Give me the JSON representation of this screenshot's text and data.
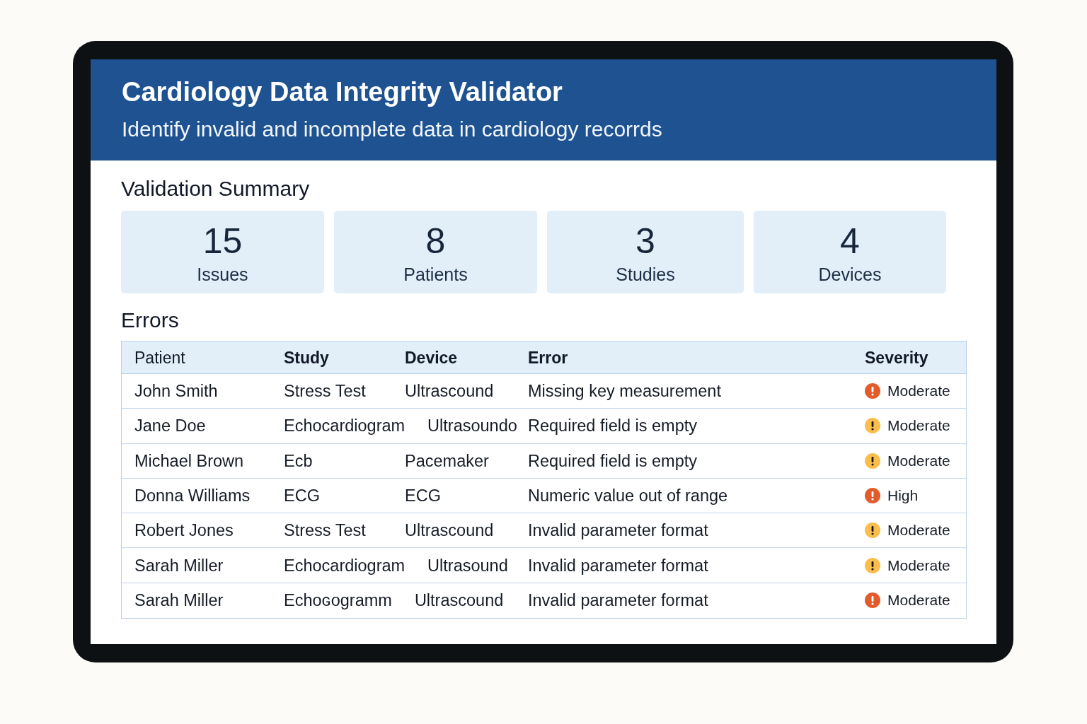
{
  "header": {
    "title": "Cardiology Data Integrity Validator",
    "subtitle": "Identify invalid and incomplete data in cardiology recorrds"
  },
  "summary": {
    "title": "Validation Summary",
    "cards": [
      {
        "value": "15",
        "label": "Issues"
      },
      {
        "value": "8",
        "label": "Patients"
      },
      {
        "value": "3",
        "label": "Studies"
      },
      {
        "value": "4",
        "label": "Devices"
      }
    ]
  },
  "errors": {
    "title": "Errors",
    "columns": [
      {
        "label": "Patient",
        "bold": false
      },
      {
        "label": "Study",
        "bold": true
      },
      {
        "label": "Device",
        "bold": true
      },
      {
        "label": "Error",
        "bold": true
      },
      {
        "label": "Severity",
        "bold": true
      }
    ],
    "rows": [
      {
        "patient": "John Smith",
        "study": "Stress Test",
        "device": "Ultrascound",
        "error": "Missing key measurement",
        "severity": {
          "label": "Moderate",
          "color": "#e35b2b"
        }
      },
      {
        "patient": "Jane Doe",
        "study": "Echocardiogram",
        "device": "Ultrasoundo",
        "error": "Required field is empty",
        "severity": {
          "label": "Moderate",
          "color": "#fbbd4c"
        }
      },
      {
        "patient": "Michael Brown",
        "study": "Ecb",
        "device": "Pacemaker",
        "error": "Required field is empty",
        "severity": {
          "label": "Moderate",
          "color": "#fbbd4c"
        }
      },
      {
        "patient": "Donna Williams",
        "study": "ECG",
        "device": "ECG",
        "error": "Numeric value out of range",
        "severity": {
          "label": "High",
          "color": "#e35b2b"
        }
      },
      {
        "patient": "Robert Jones",
        "study": "Stress Test",
        "device": "Ultrascound",
        "error": "Invalid parameter format",
        "severity": {
          "label": "Moderate",
          "color": "#fbbd4c"
        }
      },
      {
        "patient": "Sarah Miller",
        "study": "Echocardiogram",
        "device": "Ultrasound",
        "error": "Invalid parameter format",
        "severity": {
          "label": "Moderate",
          "color": "#fbbd4c"
        }
      },
      {
        "patient": "Sarah Miller",
        "study": "Echoɢogramm",
        "device": "Ultrascound",
        "error": "Invalid parameter format",
        "severity": {
          "label": "Moderate",
          "color": "#e35b2b"
        }
      }
    ]
  }
}
